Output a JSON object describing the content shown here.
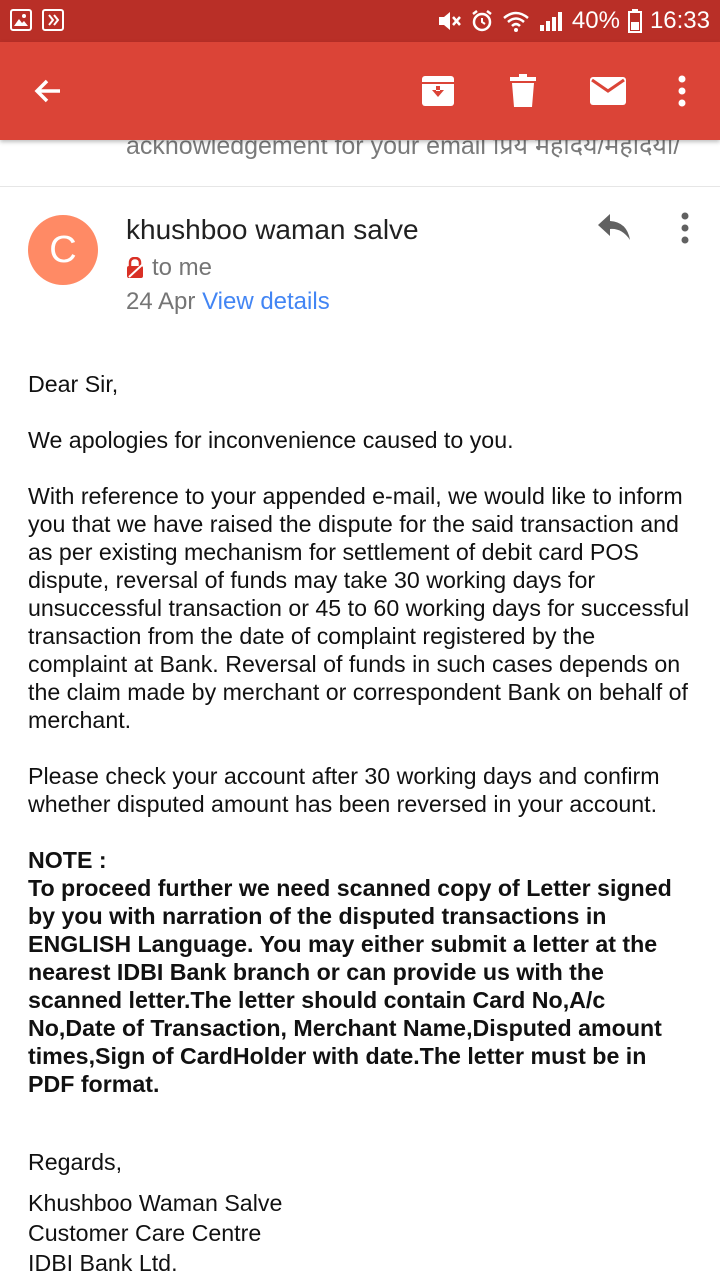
{
  "status_bar": {
    "battery": "40%",
    "time": "16:33"
  },
  "toolbar": {
    "icons": [
      "back-arrow-icon",
      "archive-icon",
      "delete-icon",
      "mail-icon",
      "more-vert-icon"
    ]
  },
  "subject_peek": "acknowledgement for your email प्रिय महोदय/महोदया/",
  "sender": {
    "avatar_letter": "C",
    "name": "khushboo waman salve",
    "to": "to me",
    "date": "24 Apr",
    "view_details": "View details"
  },
  "email": {
    "greeting": "Dear Sir,",
    "apology": "We apologies for inconvenience caused to you.",
    "para1": "With reference to your appended e-mail, we would like to inform you that we have raised the dispute for the said transaction and as per existing mechanism for settlement of debit card POS dispute, reversal of funds may take 30 working days for unsuccessful transaction or 45 to 60 working days for successful transaction from the date of complaint registered by the complaint at Bank. Reversal of funds in such cases depends on the claim made by merchant or correspondent Bank on behalf of merchant.",
    "para2": "Please check your account after 30 working days and confirm whether disputed amount has been reversed in your account.",
    "note_heading": "NOTE :",
    "note_text": "To proceed further we need scanned copy of Letter signed by you with narration of the disputed transactions in ENGLISH Language. You may either submit a letter at the nearest IDBI Bank branch or can provide us with the scanned letter.The letter should contain Card No,A/c No,Date of Transaction, Merchant Name,Disputed amount times,Sign of CardHolder with date.The letter must be in PDF format.",
    "regards": "Regards,",
    "sig_name": "Khushboo Waman Salve",
    "sig_dept": "Customer Care Centre",
    "sig_org": "IDBI Bank Ltd."
  },
  "colors": {
    "status_bar": "#b92f27",
    "toolbar": "#db4437",
    "avatar": "#ff8a65",
    "link": "#4285f4"
  }
}
